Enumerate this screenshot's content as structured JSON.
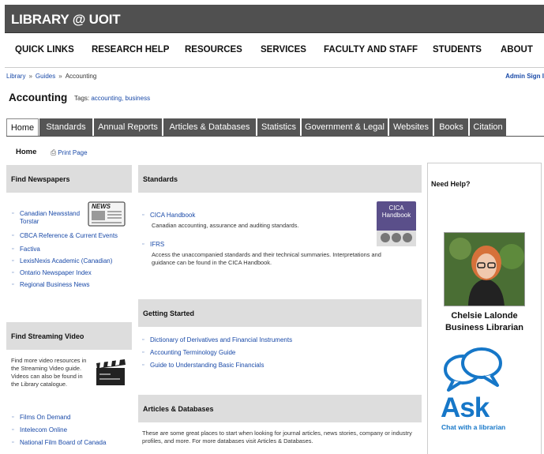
{
  "header": {
    "title": "LIBRARY @ UOIT"
  },
  "nav": [
    "QUICK LINKS",
    "RESEARCH HELP",
    "RESOURCES",
    "SERVICES",
    "FACULTY AND STAFF",
    "STUDENTS",
    "ABOUT"
  ],
  "breadcrumb": [
    "Library",
    "Guides",
    "Accounting"
  ],
  "admin_link": "Admin Sign I",
  "page": {
    "title": "Accounting",
    "tags_label": "Tags:",
    "tags": "accounting, business"
  },
  "tabs": [
    "Home",
    "Standards",
    "Annual Reports",
    "Articles & Databases",
    "Statistics",
    "Government & Legal",
    "Websites",
    "Books",
    "Citation"
  ],
  "subnav": {
    "home": "Home",
    "print": "Print Page"
  },
  "find_newspapers": {
    "title": "Find Newspapers",
    "badge": "NEWS",
    "items": [
      "Canadian Newsstand Torstar",
      "CBCA Reference & Current Events",
      "Factiva",
      "LexisNexis Academic (Canadian)",
      "Ontario Newspaper Index",
      "Regional Business News"
    ]
  },
  "find_video": {
    "title": "Find Streaming Video",
    "intro": "Find more video resources in the Streaming Video guide. Videos can also be found in the Library catalogue.",
    "items": [
      "Films On Demand",
      "Intelecom Online",
      "National Film Board of Canada"
    ]
  },
  "standards": {
    "title": "Standards",
    "book_label": "CICA Handbook",
    "items": [
      {
        "name": "CICA Handbook",
        "desc": "Canadian accounting, assurance and auditing standards."
      },
      {
        "name": "IFRS",
        "desc": "Access the unaccompanied standards and their technical summaries. Interpretations and guidance can be found in the CICA Handbook."
      }
    ]
  },
  "getting_started": {
    "title": "Getting Started",
    "items": [
      "Dictionary of Derivatives and Financial Instruments",
      "Accounting Terminology Guide",
      "Guide to Understanding Basic Financials"
    ]
  },
  "articles": {
    "title": "Articles & Databases",
    "desc": "These are some great places to start when looking for journal articles, news stories, company or industry profiles, and more. For more databases visit Articles & Databases."
  },
  "help": {
    "title": "Need Help?",
    "name": "Chelsie Lalonde",
    "role": "Business Librarian",
    "ask": "Ask",
    "ask_sub": "Chat with a librarian"
  },
  "colors": {
    "topbar": "#505050",
    "tab": "#555555",
    "link": "#1a4aa8",
    "ask": "#1677c8"
  }
}
